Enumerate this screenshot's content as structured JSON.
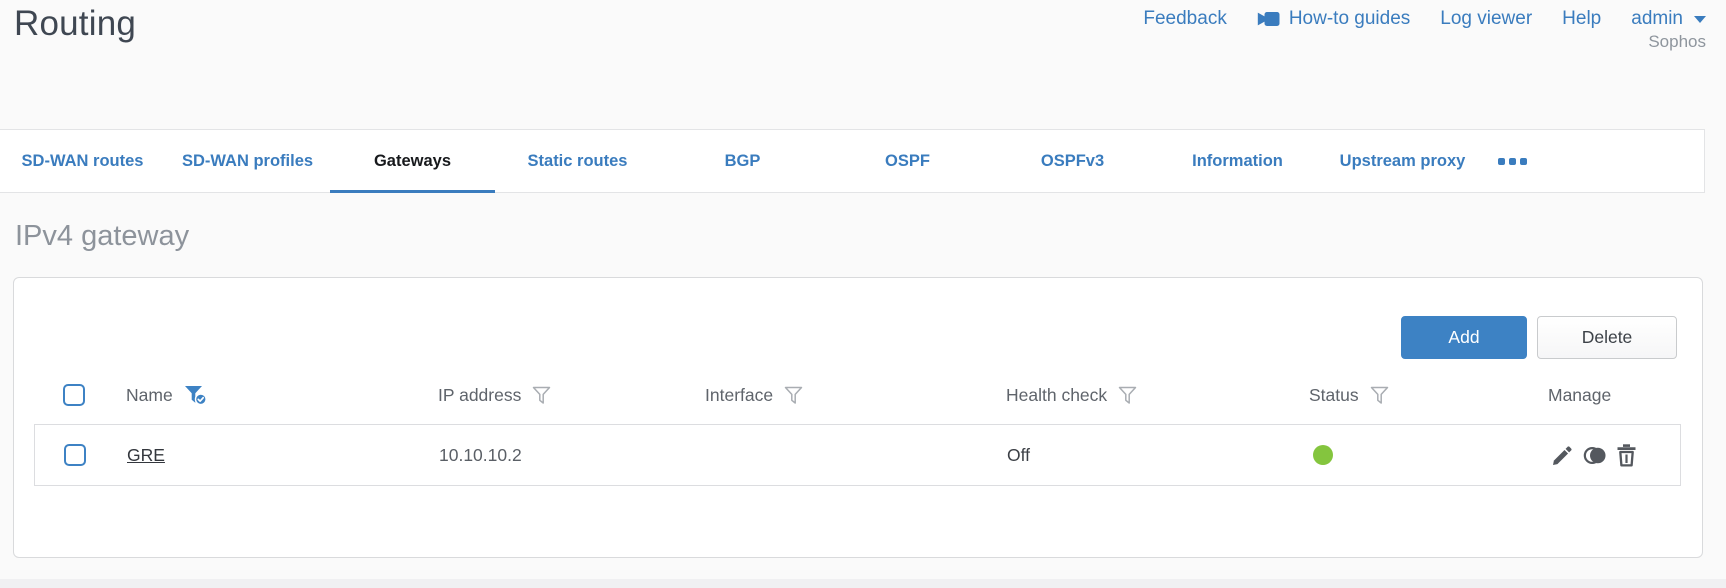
{
  "window": {
    "title": "Routing",
    "brand": "Sophos"
  },
  "topnav": {
    "feedback": "Feedback",
    "howto_guides": "How-to guides",
    "log_viewer": "Log viewer",
    "help": "Help",
    "user": "admin",
    "howto_icon": "video-camera-icon",
    "user_caret_icon": "chevron-down-icon"
  },
  "tabs": [
    {
      "label": "SD-WAN routes",
      "active": false
    },
    {
      "label": "SD-WAN profiles",
      "active": false
    },
    {
      "label": "Gateways",
      "active": true
    },
    {
      "label": "Static routes",
      "active": false
    },
    {
      "label": "BGP",
      "active": false
    },
    {
      "label": "OSPF",
      "active": false
    },
    {
      "label": "OSPFv3",
      "active": false
    },
    {
      "label": "Information",
      "active": false
    },
    {
      "label": "Upstream proxy",
      "active": false
    }
  ],
  "tabs_overflow_icon": "more-ellipsis-icon",
  "section": {
    "heading": "IPv4 gateway"
  },
  "toolbar": {
    "add_label": "Add",
    "delete_label": "Delete"
  },
  "table": {
    "columns": [
      {
        "label": "Name",
        "filter_icon": "funnel-filter-icon",
        "filter_state": "active"
      },
      {
        "label": "IP address",
        "filter_icon": "funnel-filter-icon",
        "filter_state": "default"
      },
      {
        "label": "Interface",
        "filter_icon": "funnel-filter-icon",
        "filter_state": "default"
      },
      {
        "label": "Health check",
        "filter_icon": "funnel-filter-icon",
        "filter_state": "default"
      },
      {
        "label": "Status",
        "filter_icon": "funnel-filter-icon",
        "filter_state": "default"
      },
      {
        "label": "Manage",
        "filter_icon": null,
        "filter_state": "none"
      }
    ],
    "rows": [
      {
        "name": "GRE",
        "ip_address": "10.10.10.2",
        "interface": "",
        "health_check": "Off",
        "status": "up",
        "actions": [
          "edit",
          "clone",
          "delete"
        ]
      }
    ]
  },
  "colors": {
    "accent_blue": "#3a7cbe",
    "button_blue": "#3d82c4",
    "status_up_green": "#84c53e",
    "heading_gray": "#8d939b",
    "page_background": "#fafafa"
  }
}
